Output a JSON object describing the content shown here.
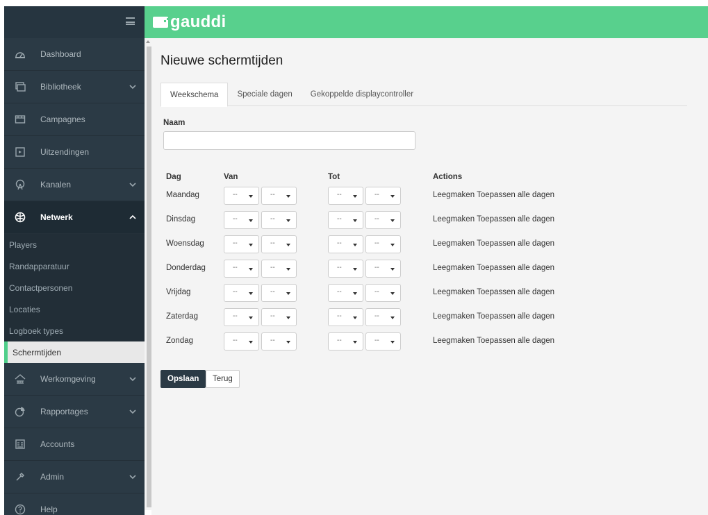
{
  "brand": {
    "name": "gauddi",
    "color": "#58d08d"
  },
  "sidebar": {
    "items": [
      {
        "label": "Dashboard",
        "icon": "dashboard-icon",
        "chevron": false
      },
      {
        "label": "Bibliotheek",
        "icon": "library-icon",
        "chevron": true
      },
      {
        "label": "Campagnes",
        "icon": "campaign-icon",
        "chevron": false
      },
      {
        "label": "Uitzendingen",
        "icon": "broadcast-icon",
        "chevron": false
      },
      {
        "label": "Kanalen",
        "icon": "channels-icon",
        "chevron": true
      },
      {
        "label": "Netwerk",
        "icon": "network-icon",
        "chevron": true,
        "expanded": true
      }
    ],
    "network_sub": [
      "Players",
      "Randapparatuur",
      "Contactpersonen",
      "Locaties",
      "Logboek types",
      "Schermtijden"
    ],
    "current_sub": "Schermtijden",
    "items_after": [
      {
        "label": "Werkomgeving",
        "icon": "workspace-icon",
        "chevron": true
      },
      {
        "label": "Rapportages",
        "icon": "reports-icon",
        "chevron": true
      },
      {
        "label": "Accounts",
        "icon": "accounts-icon",
        "chevron": false
      },
      {
        "label": "Admin",
        "icon": "admin-icon",
        "chevron": true
      },
      {
        "label": "Help",
        "icon": "help-icon",
        "chevron": false
      }
    ]
  },
  "main": {
    "title": "Nieuwe schermtijden",
    "tabs": [
      "Weekschema",
      "Speciale dagen",
      "Gekoppelde displaycontroller"
    ],
    "active_tab": "Weekschema",
    "name_label": "Naam",
    "name_value": "",
    "headers": {
      "day": "Dag",
      "from": "Van",
      "to": "Tot",
      "actions": "Actions"
    },
    "days": [
      "Maandag",
      "Dinsdag",
      "Woensdag",
      "Donderdag",
      "Vrijdag",
      "Zaterdag",
      "Zondag"
    ],
    "select_placeholder": "--",
    "action_clear": "Leegmaken",
    "action_apply": "Toepassen alle dagen",
    "save_label": "Opslaan",
    "back_label": "Terug"
  }
}
